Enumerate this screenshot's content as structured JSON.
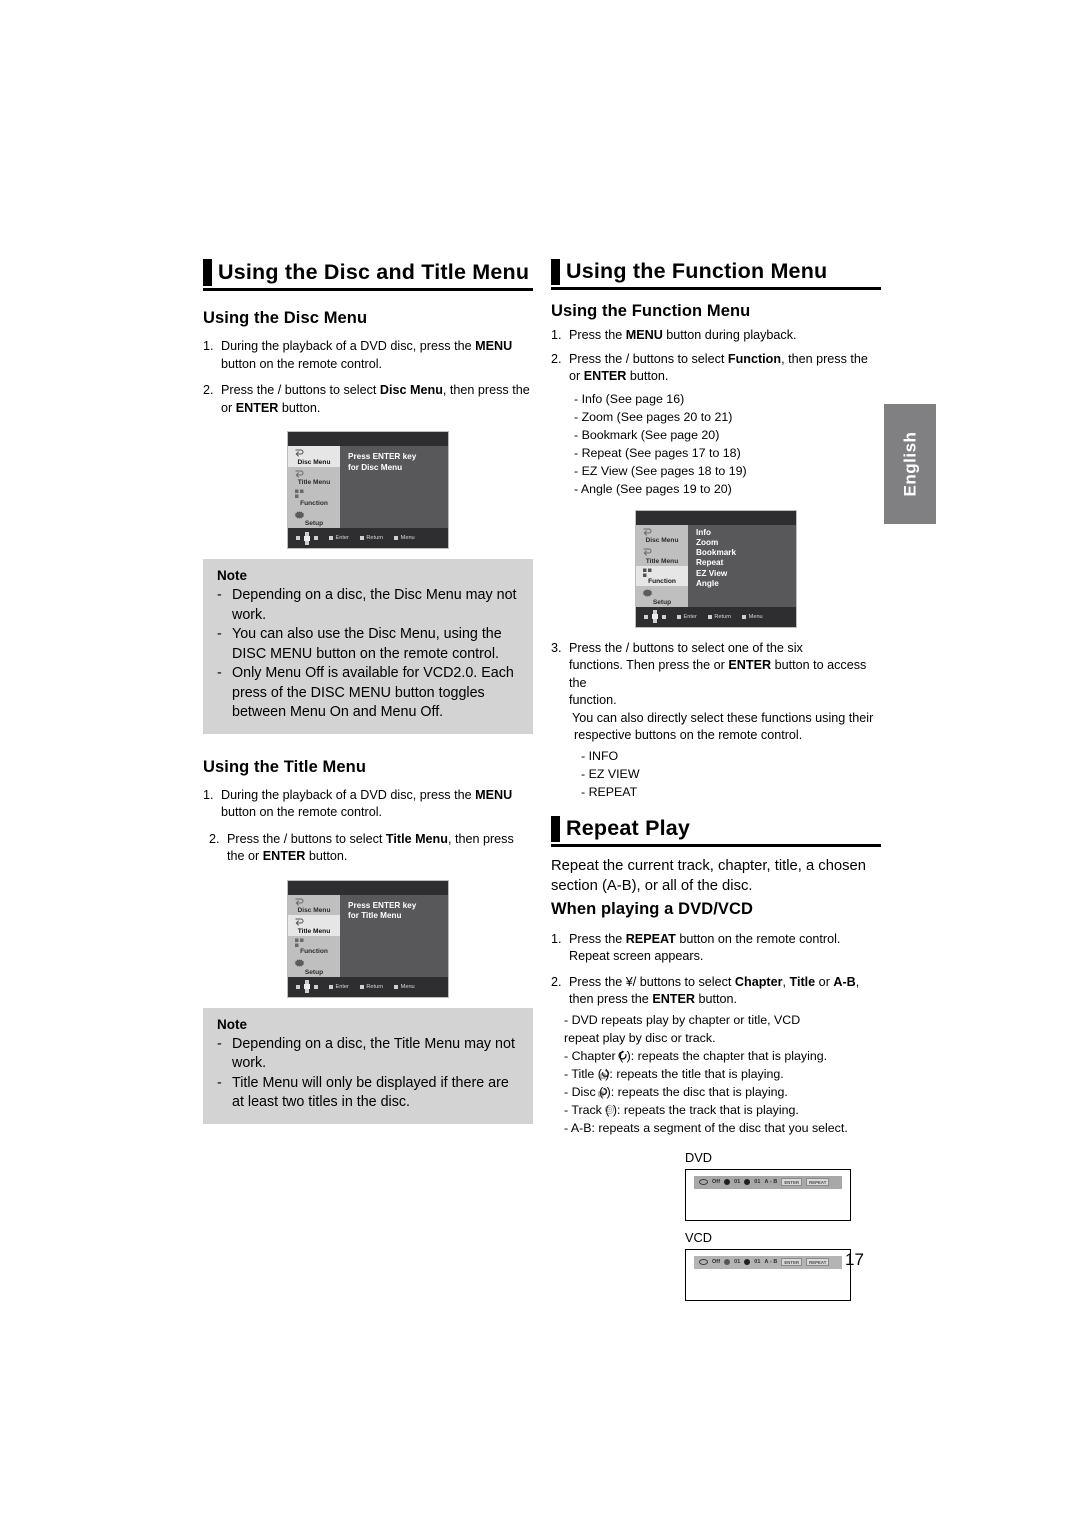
{
  "page": {
    "number": "17",
    "language_tab": "English"
  },
  "left_column": {
    "section_title": "Using the Disc and Title Menu",
    "disc_menu": {
      "heading": "Using the Disc Menu",
      "steps": [
        {
          "n": "1.",
          "pre": "During the playback of a DVD disc, press the ",
          "b1": "MENU",
          "mid": " button on the remote control.",
          "b2": "",
          "post": ""
        },
        {
          "n": "2.",
          "pre": "Press the      /     buttons to select ",
          "b1": "Disc Menu",
          "mid": ", then press the      or ",
          "b2": "ENTER",
          "post": " button."
        }
      ],
      "osd": {
        "sidebar": [
          {
            "label": "Disc Menu",
            "icon": "disc-menu-icon",
            "selected": true
          },
          {
            "label": "Title Menu",
            "icon": "title-menu-icon",
            "selected": false
          },
          {
            "label": "Function",
            "icon": "function-icon",
            "selected": false
          },
          {
            "label": "Setup",
            "icon": "setup-gear-icon",
            "selected": false
          }
        ],
        "main_text_line1": "Press ENTER key",
        "main_text_line2": "for Disc Menu",
        "footer": [
          "Enter",
          "Return",
          "Menu"
        ]
      },
      "note": {
        "title": "Note",
        "items": [
          "Depending on a disc, the Disc Menu may not work.",
          "You can also use the Disc Menu, using the DISC MENU button on the remote control.",
          "Only Menu Off is available for VCD2.0. Each press of the DISC MENU button toggles between Menu On and Menu Off."
        ]
      }
    },
    "title_menu": {
      "heading": "Using the Title Menu",
      "steps": [
        {
          "n": "1.",
          "pre": "During the playback of a DVD disc, press the ",
          "b1": "MENU",
          "mid": " button on the remote control.",
          "b2": "",
          "post": ""
        },
        {
          "n": "2.",
          "pre": "Press the      /     buttons to select ",
          "b1": "Title Menu",
          "mid": ", then press the      or ",
          "b2": "ENTER",
          "post": " button."
        }
      ],
      "osd": {
        "sidebar": [
          {
            "label": "Disc Menu",
            "icon": "disc-menu-icon",
            "selected": false
          },
          {
            "label": "Title Menu",
            "icon": "title-menu-icon",
            "selected": true
          },
          {
            "label": "Function",
            "icon": "function-icon",
            "selected": false
          },
          {
            "label": "Setup",
            "icon": "setup-gear-icon",
            "selected": false
          }
        ],
        "main_text_line1": "Press ENTER key",
        "main_text_line2": "for Title Menu",
        "footer": [
          "Enter",
          "Return",
          "Menu"
        ]
      },
      "note": {
        "title": "Note",
        "items": [
          "Depending on a disc, the Title Menu may not work.",
          "Title Menu will only be displayed if there are at least two titles in the disc."
        ]
      }
    }
  },
  "right_column": {
    "section_title": "Using the Function Menu",
    "function_menu": {
      "heading": "Using the Function Menu",
      "step1": {
        "n": "1.",
        "pre": "Press the ",
        "b1": "MENU",
        "post": " button during playback."
      },
      "step2": {
        "n": "2.",
        "pre": "Press the      /     buttons to select ",
        "b1": "Function",
        "mid": ", then press the      or ",
        "b2": "ENTER",
        "post": " button."
      },
      "function_list": [
        "- Info (See page 16)",
        "- Zoom (See pages 20 to 21)",
        "- Bookmark (See page 20)",
        "- Repeat (See pages 17 to 18)",
        "- EZ View (See pages 18 to 19)",
        "- Angle (See pages 19 to 20)"
      ],
      "osd": {
        "sidebar": [
          {
            "label": "Disc Menu",
            "icon": "disc-menu-icon",
            "selected": false
          },
          {
            "label": "Title Menu",
            "icon": "title-menu-icon",
            "selected": false
          },
          {
            "label": "Function",
            "icon": "function-icon",
            "selected": true
          },
          {
            "label": "Setup",
            "icon": "setup-gear-icon",
            "selected": false
          }
        ],
        "menu_items": [
          "Info",
          "Zoom",
          "Bookmark",
          "Repeat",
          "EZ View",
          "Angle"
        ],
        "footer": [
          "Enter",
          "Return",
          "Menu"
        ]
      },
      "step3": {
        "n": "3.",
        "line1_pre": "Press the      /     buttons to select one of the six",
        "line2_pre": "functions. Then press the      or ",
        "line2_b": "ENTER",
        "line2_post": " button to access the",
        "line3": "function.",
        "line4": "You can also directly select these functions using their",
        "line5": "respective buttons on the remote control."
      },
      "direct_buttons": [
        "- INFO",
        "- EZ VIEW",
        "- REPEAT"
      ]
    },
    "repeat_play": {
      "section_title": "Repeat Play",
      "intro_line1": "Repeat the current track, chapter, title, a chosen",
      "intro_line2": "section (A-B), or all of the disc.",
      "heading": "When playing a DVD/VCD",
      "step1": {
        "n": "1.",
        "line1_pre": "Press the ",
        "line1_b": "REPEAT",
        "line1_post": " button on the remote control.",
        "line2": "Repeat screen appears."
      },
      "step2": {
        "n": "2.",
        "pre": "Press the  ¥/     buttons to select ",
        "b1": "Chapter",
        "mid1": ", ",
        "b2": "Title",
        "mid2": " or ",
        "b3": "A-B",
        "post": ",",
        "line2_pre": "then press the ",
        "line2_b": "ENTER",
        "line2_post": " button."
      },
      "bullets": [
        "- DVD repeats play by chapter or title, VCD",
        "   repeat play by disc or track.",
        "- Chapter (      ): repeats the chapter that is playing.",
        "- Title (      ): repeats the title that is playing.",
        "- Disc (      ): repeats the disc that is playing.",
        "- Track (      ): repeats the track that is playing.",
        "- A-B: repeats a segment of the disc that you select."
      ],
      "osd_examples": [
        {
          "label": "DVD",
          "bar": {
            "off": "Off",
            "chapter": "01",
            "title": "01",
            "ab": "A - B",
            "key_enter": "ENTER",
            "key_repeat": "REPEAT"
          }
        },
        {
          "label": "VCD",
          "bar": {
            "off": "Off",
            "chapter": "01",
            "title": "01",
            "ab": "A - B",
            "key_enter": "ENTER",
            "key_repeat": "REPEAT"
          }
        }
      ]
    }
  }
}
